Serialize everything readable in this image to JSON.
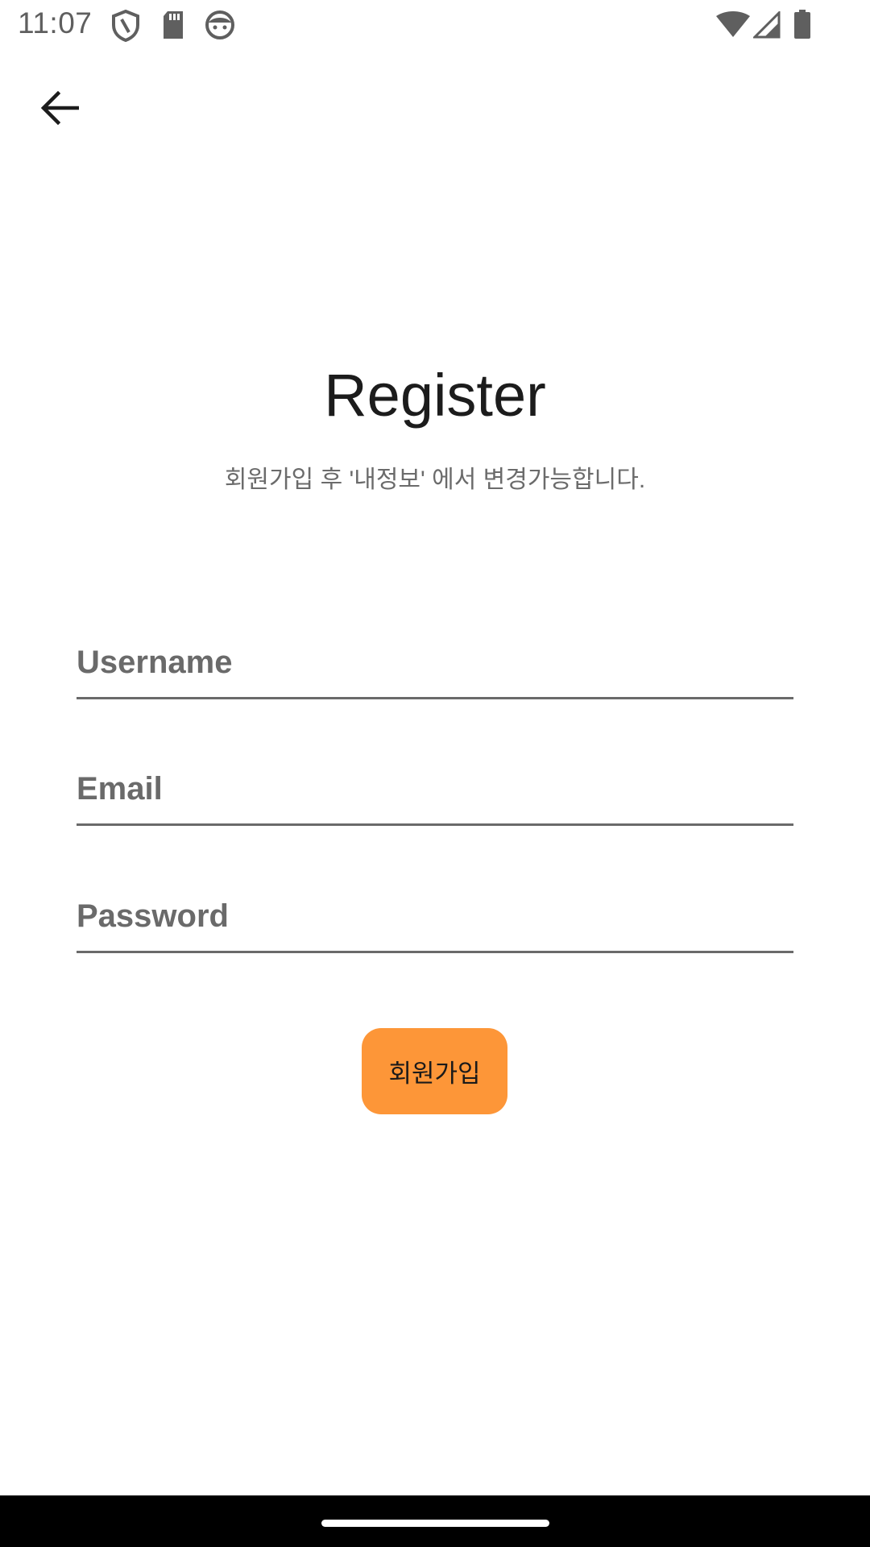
{
  "status_bar": {
    "time": "11:07",
    "left_icons": [
      "shield-icon",
      "sd-card-icon",
      "face-icon"
    ],
    "right_icons": [
      "wifi-icon",
      "signal-icon",
      "battery-icon"
    ]
  },
  "app_bar": {
    "back_icon": "arrow-back-icon"
  },
  "header": {
    "title": "Register",
    "subtitle": "회원가입 후 '내정보' 에서 변경가능합니다."
  },
  "form": {
    "username": {
      "placeholder": "Username",
      "value": ""
    },
    "email": {
      "placeholder": "Email",
      "value": ""
    },
    "password": {
      "placeholder": "Password",
      "value": ""
    },
    "submit_label": "회원가입"
  },
  "colors": {
    "accent": "#fd9638",
    "field_underline": "#6a6a6a",
    "title": "#1c1c1c",
    "subtitle": "#6b6b6b",
    "nav_bar": "#000000"
  }
}
